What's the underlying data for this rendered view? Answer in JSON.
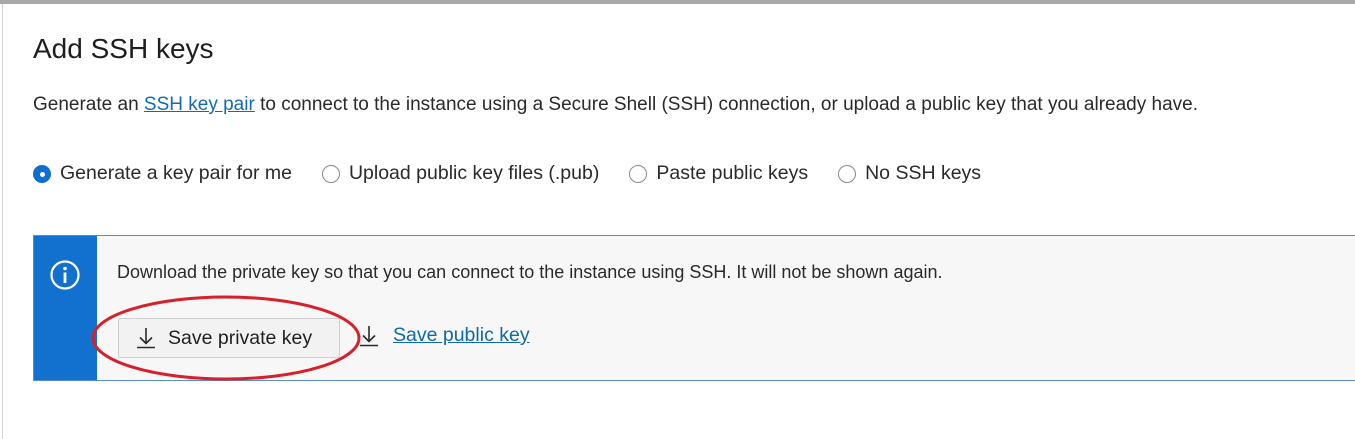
{
  "title": "Add SSH keys",
  "description": {
    "before": "Generate an ",
    "link": "SSH key pair",
    "after": " to connect to the instance using a Secure Shell (SSH) connection, or upload a public key that you already have."
  },
  "radio_options": [
    {
      "label": "Generate a key pair for me",
      "selected": true
    },
    {
      "label": "Upload public key files (.pub)",
      "selected": false
    },
    {
      "label": "Paste public keys",
      "selected": false
    },
    {
      "label": "No SSH keys",
      "selected": false
    }
  ],
  "notice": {
    "icon": "info-icon",
    "text": "Download the private key so that you can connect to the instance using SSH. It will not be shown again.",
    "save_private_label": "Save private key",
    "save_public_label": "Save public key"
  },
  "colors": {
    "accent": "#1270cf",
    "link": "#0e6aa6",
    "highlight_ellipse": "#d6202b"
  }
}
